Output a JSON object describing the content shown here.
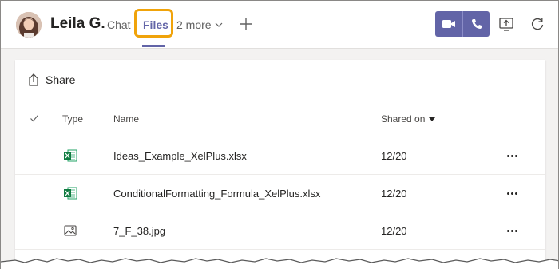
{
  "header": {
    "contact_name": "Leila G.",
    "tabs": [
      {
        "label": "Chat",
        "active": false
      },
      {
        "label": "Files",
        "active": true
      },
      {
        "label": "2 more",
        "active": false
      }
    ],
    "accent_color": "#6264a7",
    "highlight_color": "#f0a30a",
    "icons": [
      "avatar",
      "chevron-down-icon",
      "plus-icon",
      "video-call-icon",
      "phone-call-icon",
      "share-screen-icon",
      "refresh-icon"
    ]
  },
  "files_panel": {
    "share_label": "Share",
    "columns": {
      "type": "Type",
      "name": "Name",
      "shared_on": "Shared on"
    },
    "rows": [
      {
        "type_icon": "excel-icon",
        "name": "Ideas_Example_XelPlus.xlsx",
        "shared_on": "12/20"
      },
      {
        "type_icon": "excel-icon",
        "name": "ConditionalFormatting_Formula_XelPlus.xlsx",
        "shared_on": "12/20"
      },
      {
        "type_icon": "image-icon",
        "name": "7_F_38.jpg",
        "shared_on": "12/20"
      }
    ]
  }
}
